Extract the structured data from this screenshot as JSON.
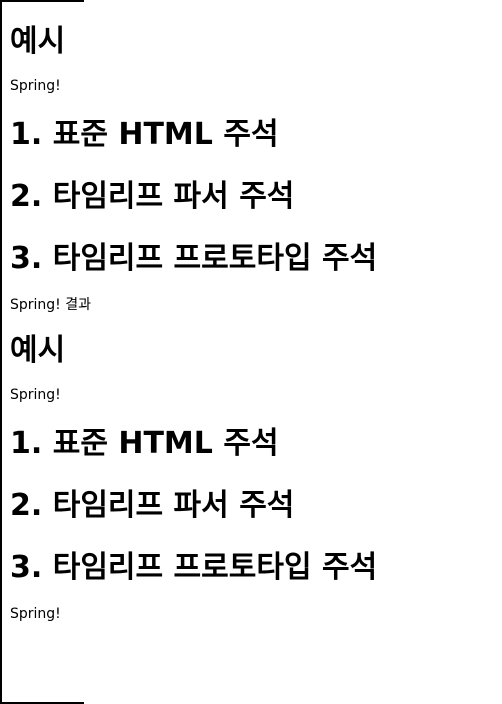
{
  "section1": {
    "title": "예시",
    "text_spring": "Spring!",
    "heading1": "1. 표준 HTML 주석",
    "heading2": "2. 타임리프 파서 주석",
    "heading3": "3. 타임리프 프로토타입 주석",
    "text_result": "Spring! 결과"
  },
  "section2": {
    "title": "예시",
    "text_spring": "Spring!",
    "heading1": "1. 표준 HTML 주석",
    "heading2": "2. 타임리프 파서 주석",
    "heading3": "3. 타임리프 프로토타입 주석",
    "text_end": "Spring!"
  },
  "colors": {
    "text": "#000000",
    "background": "#ffffff",
    "frame_line": "#000000"
  }
}
